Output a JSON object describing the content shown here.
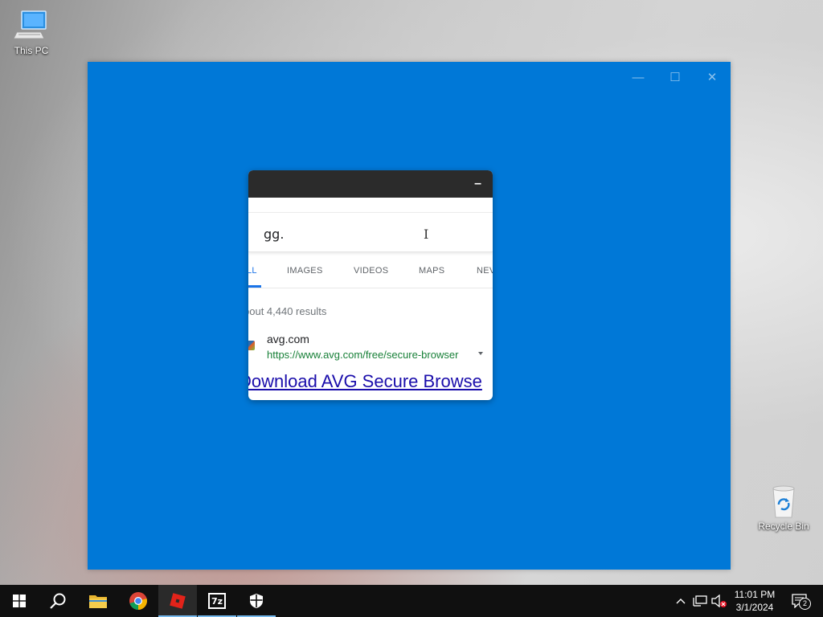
{
  "desktop": {
    "icons": [
      {
        "label": "This PC"
      },
      {
        "label": "Recycle Bin"
      }
    ]
  },
  "window": {
    "minimize": "—",
    "maximize": "☐",
    "close": "✕"
  },
  "popup": {
    "minimize": "–",
    "search_value": "gg.",
    "cursor_glyph": "I",
    "tabs": [
      "LL",
      "IMAGES",
      "VIDEOS",
      "MAPS",
      "NEV"
    ],
    "result_count": "bout 4,440 results",
    "result": {
      "site": "avg.com",
      "url": "https://www.avg.com/free/secure-browser",
      "title": "Download AVG Secure Browse"
    }
  },
  "taskbar": {
    "time": "11:01 PM",
    "date": "3/1/2024",
    "notifications": "2",
    "seven_zip_label": "7z"
  },
  "colors": {
    "window_blue": "#0078d7",
    "link": "#1a0dab",
    "url_green": "#188038",
    "tab_accent": "#1a73e8"
  }
}
